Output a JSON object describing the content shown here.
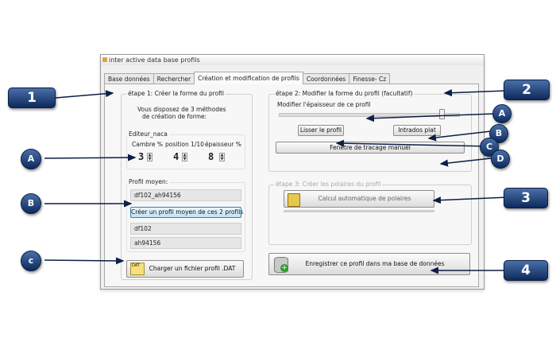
{
  "window": {
    "title": "inter active data base profils",
    "tabs": [
      "Base données",
      "Rechercher",
      "Création et modification de profils",
      "Coordonnées",
      "Finesse- Cz"
    ]
  },
  "step1": {
    "legend": "étape 1: Créer la forme du profil",
    "intro_line1": "Vous disposez de 3 méthodes",
    "intro_line2": "de création de forme:",
    "editor_title": "Editeur_naca",
    "cambre_label": "Cambre %",
    "position_label": "position 1/10",
    "epaisseur_label": "épaisseur %",
    "cambre_value": "3",
    "position_value": "4",
    "epaisseur_value": "8",
    "profil_moyen_label": "Profil moyen:",
    "profil_moyen_value": "df102_ah94156",
    "create_avg_button": "Créer un profil moyen de ces 2 profils",
    "profile_a": "df102",
    "profile_b": "ah94156",
    "load_dat_button": "Charger un fichier profil .DAT",
    "dat_icon_label": "DAT"
  },
  "step2": {
    "legend": "étape 2: Modifier la forme du profil (facultatif)",
    "thickness_label": "Modifier l'épaisseur de ce profil",
    "slider_level": 0.92,
    "smooth_button": "Lisser le profil",
    "intrados_button": "Intrados plat",
    "manual_button": "Fenetre de tracage manuel"
  },
  "step3": {
    "legend": "étape 3: Créer les polaires du profil",
    "auto_polar_button": "Calcul automatique de polaires"
  },
  "save_button": "Enregistrer ce profil dans ma base de données",
  "markers": {
    "m1": "1",
    "m2": "2",
    "m3": "3",
    "m4": "4",
    "A_left": "A",
    "B_left": "B",
    "C_left": "c",
    "A_right": "A",
    "B_right": "B",
    "C_right": "C",
    "D_right": "D"
  },
  "colors": {
    "marker_blue": "#1c3f7a",
    "arrow": "#0d1f45"
  }
}
